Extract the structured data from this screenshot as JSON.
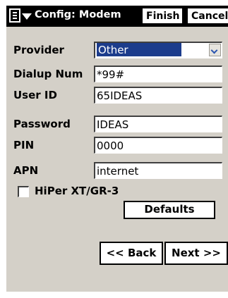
{
  "window": {
    "title": "Config: Modem",
    "finish_label": "Finish",
    "cancel_label": "Cancel"
  },
  "form": {
    "provider": {
      "label": "Provider",
      "value": "Other"
    },
    "dialup": {
      "label": "Dialup Num",
      "value": "*99#"
    },
    "user_id": {
      "label": "User ID",
      "value": "65IDEAS"
    },
    "password": {
      "label": "Password",
      "value": "IDEAS"
    },
    "pin": {
      "label": "PIN",
      "value": "0000"
    },
    "apn": {
      "label": "APN",
      "value": "internet"
    },
    "hiper_checkbox": {
      "label": "HiPer XT/GR-3",
      "checked": false
    }
  },
  "buttons": {
    "defaults": "Defaults",
    "back": "<< Back",
    "next": "Next >>"
  },
  "icons": [
    "menu-icon",
    "dropdown-arrow-icon"
  ]
}
